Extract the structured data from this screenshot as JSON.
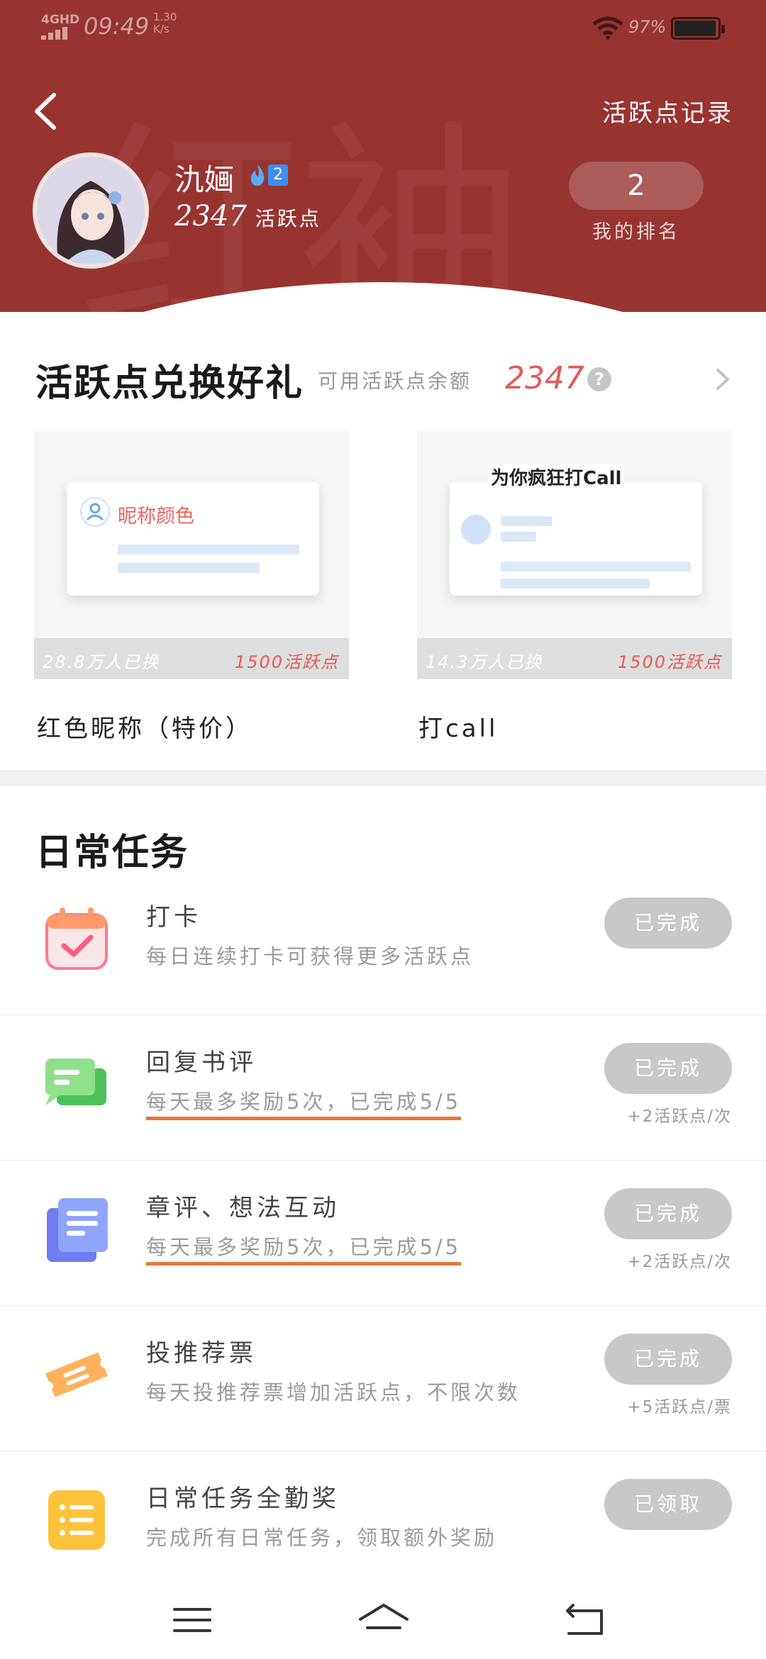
{
  "status": {
    "network": "4G",
    "network_sub": "HD",
    "time": "09:49",
    "speed_top": "1.30",
    "speed_bottom": "K/s",
    "battery": "97%"
  },
  "header": {
    "back_icon": "chevron-left-icon",
    "record_label": "活跃点记录"
  },
  "profile": {
    "name": "氿婳",
    "level": "2",
    "points": "2347",
    "points_unit": "活跃点",
    "rank": "2",
    "rank_label": "我的排名"
  },
  "exchange": {
    "title": "活跃点兑换好礼",
    "balance_label": "可用活跃点余额",
    "balance": "2347",
    "help_glyph": "?",
    "cards": [
      {
        "name": "红色昵称（特价）",
        "preview_label": "昵称颜色",
        "exchanged": "28.8万人已换",
        "price": "1500活跃点"
      },
      {
        "name": "打call",
        "preview_label": "为你疯狂打Call",
        "exchanged": "14.3万人已换",
        "price": "1500活跃点"
      }
    ]
  },
  "tasks": {
    "title": "日常任务",
    "items": [
      {
        "icon": "calendar-check-icon",
        "title": "打卡",
        "desc": "每日连续打卡可获得更多活跃点",
        "button": "已完成",
        "reward": ""
      },
      {
        "icon": "chat-bubble-icon",
        "title": "回复书评",
        "desc": "每天最多奖励5次，已完成5/5",
        "button": "已完成",
        "reward": "+2活跃点/次"
      },
      {
        "icon": "document-icon",
        "title": "章评、想法互动",
        "desc": "每天最多奖励5次，已完成5/5",
        "button": "已完成",
        "reward": "+2活跃点/次"
      },
      {
        "icon": "ticket-icon",
        "title": "投推荐票",
        "desc": "每天投推荐票增加活跃点，不限次数",
        "button": "已完成",
        "reward": "+5活跃点/票"
      },
      {
        "icon": "list-icon",
        "title": "日常任务全勤奖",
        "desc": "完成所有日常任务，领取额外奖励",
        "button": "已领取",
        "reward": ""
      }
    ]
  },
  "colors": {
    "header_bg": "#983430",
    "accent_red": "#e25b57",
    "badge_blue": "#3d8ef0",
    "disabled_button": "#c8c8c8"
  }
}
